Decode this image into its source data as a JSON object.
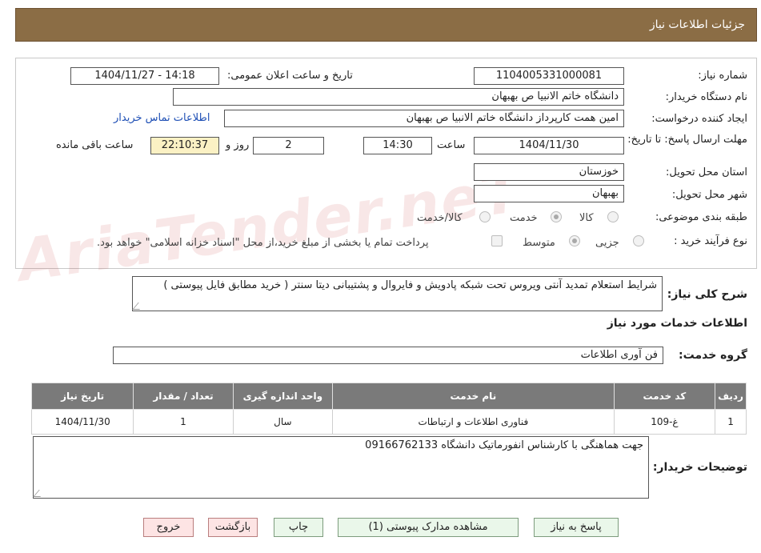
{
  "header": {
    "title": "جزئیات اطلاعات نیاز"
  },
  "watermark": "AriaTender.neT",
  "form": {
    "need_number_label": "شماره نیاز:",
    "need_number": "1104005331000081",
    "announce_label": "تاریخ و ساعت اعلان عمومی:",
    "announce_value": "1404/11/27 - 14:18",
    "buyer_org_label": "نام دستگاه خریدار:",
    "buyer_org": "دانشگاه خاتم الانبیا  ص  بهبهان",
    "requester_label": "ایجاد کننده درخواست:",
    "requester": "امین همت کارپرداز دانشگاه خاتم الانبیا  ص  بهبهان",
    "contact_link": "اطلاعات تماس خریدار",
    "deadline_label": "مهلت ارسال پاسخ: تا تاریخ:",
    "deadline_date": "1404/11/30",
    "time_label": "ساعت",
    "deadline_time": "14:30",
    "days_value": "2",
    "days_label": "روز و",
    "remaining_time": "22:10:37",
    "remaining_label": "ساعت باقی مانده",
    "province_label": "استان محل تحویل:",
    "province": "خوزستان",
    "city_label": "شهر محل تحویل:",
    "city": "بهبهان",
    "category_label": "طبقه بندی موضوعی:",
    "category_options": [
      "کالا",
      "خدمت",
      "کالا/خدمت"
    ],
    "process_label": "نوع فرآیند خرید :",
    "process_options": [
      "جزیی",
      "متوسط"
    ],
    "payment_note": "پرداخت تمام یا بخشی از مبلغ خرید،از محل \"اسناد خزانه اسلامی\" خواهد بود."
  },
  "description": {
    "label": "شرح کلی نیاز:",
    "text": "شرایط استعلام تمدید آنتی ویروس تحت شبکه پادویش و فایروال و  پشتیبانی دیتا سنتر ( خرید مطابق فایل پیوستی )"
  },
  "services": {
    "section_title": "اطلاعات خدمات مورد نیاز",
    "group_label": "گروه خدمت:",
    "group_value": "فن آوری اطلاعات",
    "columns": [
      "ردیف",
      "کد خدمت",
      "نام خدمت",
      "واحد اندازه گیری",
      "تعداد / مقدار",
      "تاریخ نیاز"
    ],
    "rows": [
      [
        "1",
        "غ-109",
        "فناوری اطلاعات و ارتباطات",
        "سال",
        "1",
        "1404/11/30"
      ]
    ]
  },
  "buyer_notes": {
    "label": "توضیحات خریدار:",
    "text": "جهت هماهنگی با کارشناس انفورماتیک دانشگاه 09166762133"
  },
  "buttons": {
    "reply": "پاسخ به نیاز",
    "attachments": "مشاهده مدارک پیوستی (1)",
    "print": "چاپ",
    "back": "بازگشت",
    "exit": "خروج"
  }
}
